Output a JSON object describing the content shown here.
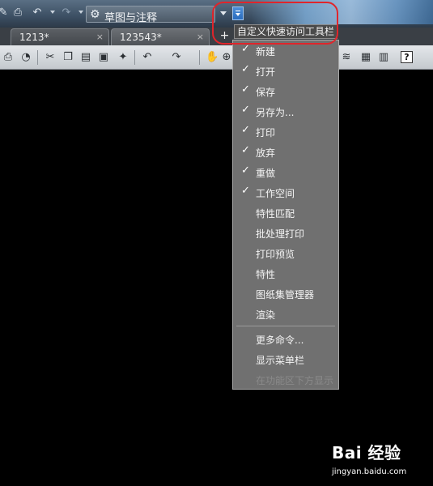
{
  "quick_access": {
    "workspace_label": "草图与注释",
    "tooltip": "自定义快速访问工具栏"
  },
  "tabs": [
    {
      "label": "1213*",
      "close": "×"
    },
    {
      "label": "123543*",
      "close": "×"
    }
  ],
  "tab_add": "+",
  "toolbar": {
    "help_label": "?"
  },
  "menu": {
    "items": [
      {
        "label": "新建",
        "checked": true,
        "check": "✓"
      },
      {
        "label": "打开",
        "checked": true,
        "check": "✓"
      },
      {
        "label": "保存",
        "checked": true,
        "check": "✓"
      },
      {
        "label": "另存为...",
        "checked": true,
        "check": "✓"
      },
      {
        "label": "打印",
        "checked": true,
        "check": "✓"
      },
      {
        "label": "放弃",
        "checked": true,
        "check": "✓"
      },
      {
        "label": "重做",
        "checked": true,
        "check": "✓"
      },
      {
        "label": "工作空间",
        "checked": true,
        "check": "✓"
      },
      {
        "label": "特性匹配",
        "checked": false
      },
      {
        "label": "批处理打印",
        "checked": false
      },
      {
        "label": "打印预览",
        "checked": false
      },
      {
        "label": "特性",
        "checked": false
      },
      {
        "label": "图纸集管理器",
        "checked": false
      },
      {
        "label": "渲染",
        "checked": false
      }
    ],
    "extra_items": [
      {
        "label": "更多命令..."
      },
      {
        "label": "显示菜单栏"
      },
      {
        "label": "在功能区下方显示",
        "disabled": true
      }
    ]
  },
  "watermark": {
    "logo": "Bai 经验",
    "url": "jingyan.baidu.com"
  }
}
